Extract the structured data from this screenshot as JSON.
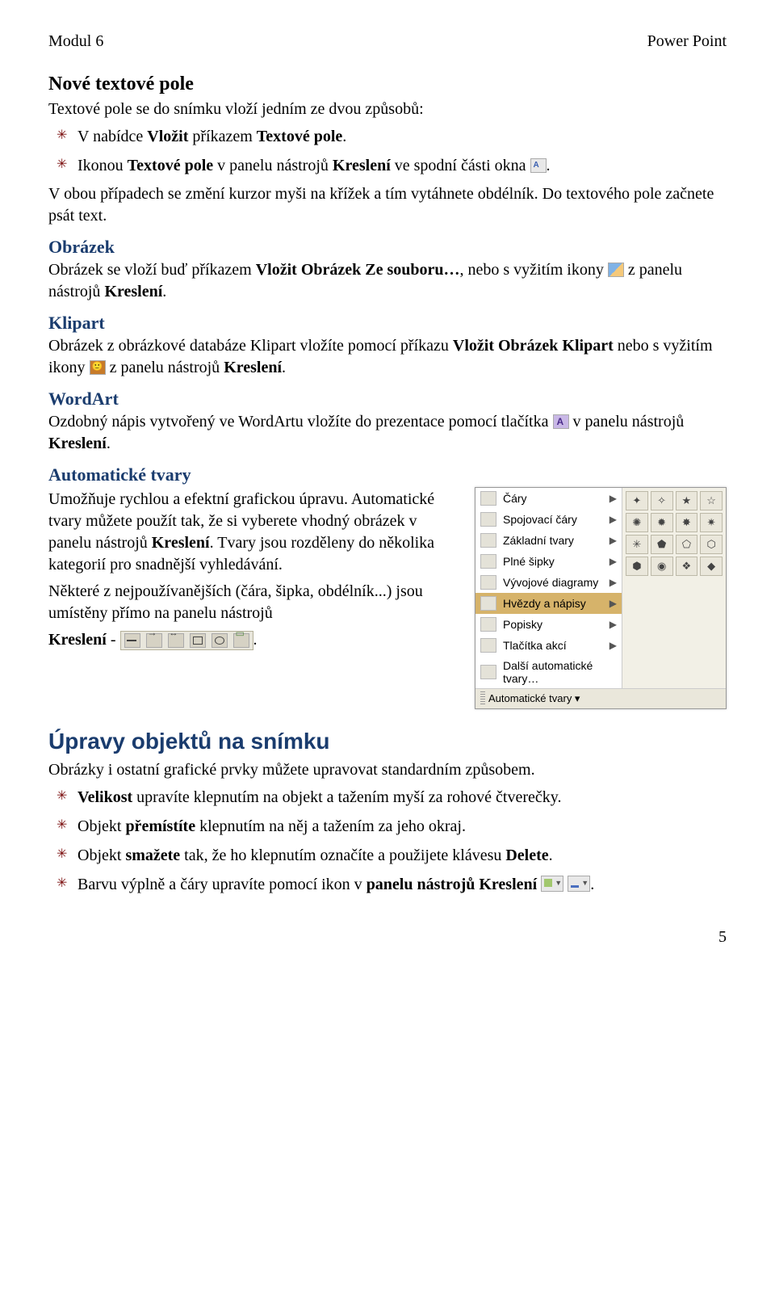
{
  "header": {
    "left": "Modul 6",
    "right": "Power Point"
  },
  "s1": {
    "title": "Nové textové pole",
    "intro": "Textové pole se do snímku vloží jedním ze dvou způsobů:",
    "b1_a": "V nabídce ",
    "b1_b": "Vložit",
    "b1_c": " příkazem ",
    "b1_d": "Textové pole",
    "b1_e": ".",
    "b2_a": "Ikonou ",
    "b2_b": "Textové pole",
    "b2_c": " v panelu nástrojů ",
    "b2_d": "Kreslení",
    "b2_e": " ve spodní části okna ",
    "after": "V obou případech se změní kurzor myši na křížek a tím vytáhnete obdélník. Do textového pole začnete psát text."
  },
  "s2": {
    "title": "Obrázek",
    "p_a": "Obrázek se vloží buď příkazem ",
    "p_b": "Vložit Obrázek Ze souboru…",
    "p_c": ", nebo s vyžitím ikony ",
    "p_d": " z panelu nástrojů ",
    "p_e": "Kreslení",
    "p_f": "."
  },
  "s3": {
    "title": "Klipart",
    "p_a": "Obrázek z obrázkové databáze Klipart vložíte pomocí příkazu ",
    "p_b": "Vložit Obrázek Klipart",
    "p_c": " nebo s vyžitím ikony ",
    "p_d": " z panelu nástrojů ",
    "p_e": "Kreslení",
    "p_f": "."
  },
  "s4": {
    "title": "WordArt",
    "p_a": "Ozdobný nápis vytvořený ve WordArtu vložíte do prezentace pomocí tlačítka ",
    "p_b": " v panelu nástrojů ",
    "p_c": "Kreslení",
    "p_d": "."
  },
  "s5": {
    "title": "Automatické tvary",
    "p1_a": "Umožňuje rychlou a efektní grafickou úpravu. Automatické tvary můžete použít tak, že si vyberete vhodný obrázek v panelu nástrojů ",
    "p1_b": "Kreslení",
    "p1_c": ". Tvary jsou rozděleny do několika kategorií pro snadnější vyhledávání.",
    "p2": "Některé z  nejpoužívanějších (čára, šipka, obdélník...) jsou umístěny přímo na panelu nástrojů",
    "p3_a": "Kreslení",
    "p3_b": " - "
  },
  "menu": {
    "items": [
      {
        "label": "Čáry"
      },
      {
        "label": "Spojovací čáry"
      },
      {
        "label": "Základní tvary"
      },
      {
        "label": "Plné šipky"
      },
      {
        "label": "Vývojové diagramy"
      },
      {
        "label": "Hvězdy a nápisy",
        "highlight": true
      },
      {
        "label": "Popisky"
      },
      {
        "label": "Tlačítka akcí"
      },
      {
        "label": "Další automatické tvary…"
      }
    ],
    "footer": "Automatické tvary ▾",
    "palette_glyphs": [
      "✦",
      "✧",
      "★",
      "☆",
      "✺",
      "✹",
      "✸",
      "✷",
      "✳",
      "⬟",
      "⬠",
      "⬡",
      "⬢",
      "◉",
      "❖",
      "◆"
    ]
  },
  "s6": {
    "title": "Úpravy objektů na snímku",
    "intro": "Obrázky i ostatní grafické prvky můžete upravovat standardním způsobem.",
    "b1_a": "Velikost",
    "b1_b": " upravíte klepnutím na objekt a tažením myší za rohové čtverečky.",
    "b2_a": "Objekt ",
    "b2_b": "přemístíte",
    "b2_c": " klepnutím na něj a tažením za jeho okraj.",
    "b3_a": "Objekt ",
    "b3_b": "smažete",
    "b3_c": " tak, že ho klepnutím označíte a použijete klávesu ",
    "b3_d": "Delete",
    "b3_e": ".",
    "b4_a": "Barvu výplně a čáry upravíte pomocí ikon v ",
    "b4_b": "panelu nástrojů Kreslení",
    "b4_c": " "
  },
  "page_number": "5"
}
